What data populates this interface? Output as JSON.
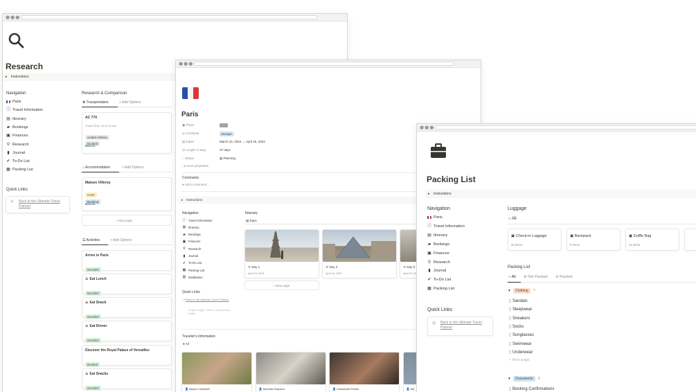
{
  "research": {
    "title": "Research",
    "instructions": "Instructions",
    "navigation_title": "Navigation",
    "nav": [
      {
        "label": "Paris",
        "icon": "flag-icon"
      },
      {
        "label": "Travel Information",
        "icon": "info-icon"
      },
      {
        "label": "Itinerary",
        "icon": "calendar-icon"
      },
      {
        "label": "Bookings",
        "icon": "ticket-icon"
      },
      {
        "label": "Finances",
        "icon": "money-icon"
      },
      {
        "label": "Research",
        "icon": "search-icon"
      },
      {
        "label": "Journal",
        "icon": "book-icon"
      },
      {
        "label": "To-Do List",
        "icon": "check-icon"
      },
      {
        "label": "Packing List",
        "icon": "luggage-icon"
      }
    ],
    "quick_links_title": "Quick Links",
    "quick_link": "Back to the Ultimate Travel Planner",
    "comparison_title": "Research & Comparison",
    "transport_tab": "Transportation",
    "add_options": "Add Options",
    "transport_card": {
      "title": "AC 774",
      "line": "Travel Time: 1h to 20 min",
      "airline": "United Airlines",
      "status": "Booked",
      "price": "$500.00"
    },
    "accommodation_tab": "Accommodation",
    "accommodation_card": {
      "title": "Maison Villeroy",
      "type": "Hotel",
      "status": "Booking",
      "price": "$320.00"
    },
    "new_page": "New page",
    "activities_tab": "Activities",
    "activities": [
      {
        "title": "Arrive in Paris",
        "status": "Decided"
      },
      {
        "title": "Eat Lunch",
        "status": "Decided"
      },
      {
        "title": "Eat Snack",
        "status": "Decided"
      },
      {
        "title": "Eat Dinner",
        "status": "Decided"
      },
      {
        "title": "Discover the Royal Palace of Versailles",
        "status": "Booked"
      },
      {
        "title": "Eat Snacks",
        "status": "Decided"
      }
    ]
  },
  "paris": {
    "title": "Paris",
    "props": [
      {
        "label": "Photo",
        "value": ""
      },
      {
        "label": "Continent",
        "value": "Europe"
      },
      {
        "label": "Dates",
        "value": "March 15, 2024 → April 25, 2024"
      },
      {
        "label": "Length of Stay",
        "value": "37 days"
      },
      {
        "label": "Status",
        "value": "Planning"
      }
    ],
    "more_props": "5 more properties",
    "comments_title": "Comments",
    "add_comment": "Add a comment...",
    "instructions": "Instructions",
    "navigation_title": "Navigation",
    "nav": [
      {
        "label": "Travel Information"
      },
      {
        "label": "Itinerary"
      },
      {
        "label": "Bookings"
      },
      {
        "label": "Finances"
      },
      {
        "label": "Research"
      },
      {
        "label": "Journal"
      },
      {
        "label": "To-Do List"
      },
      {
        "label": "Packing List"
      },
      {
        "label": "Databases"
      }
    ],
    "quick_links_title": "Quick Links",
    "quick_link": "Back to the Ultimate Travel Planner",
    "quick_link_hint": "Empty toggle. Click or drop blocks inside.",
    "itinerary_title": "Itinerary",
    "days_view": "Days",
    "days": [
      {
        "label": "Day 1",
        "date": "April 15, 2024"
      },
      {
        "label": "Day 2",
        "date": "April 16, 2024"
      },
      {
        "label": "Day 3",
        "date": "April 20, 2024"
      }
    ],
    "new_page": "New page",
    "travelers_title": "Traveler's Information",
    "travelers_view": "All",
    "travelers": [
      "Alyssa Campbell",
      "Amanda Simpson",
      "Cassandra Parker",
      "Ma"
    ]
  },
  "packing": {
    "title": "Packing List",
    "instructions": "Instructions",
    "navigation_title": "Navigation",
    "nav": [
      {
        "label": "Paris"
      },
      {
        "label": "Travel Information"
      },
      {
        "label": "Itinerary"
      },
      {
        "label": "Bookings"
      },
      {
        "label": "Finances"
      },
      {
        "label": "Research"
      },
      {
        "label": "Journal"
      },
      {
        "label": "To-Do List"
      },
      {
        "label": "Packing List"
      }
    ],
    "quick_links_title": "Quick Links",
    "quick_link": "Back to the Ultimate Travel Planner",
    "luggage_title": "Luggage",
    "luggage_view": "All",
    "luggage": [
      {
        "name": "Check-in Luggage",
        "count": "24 items"
      },
      {
        "name": "Backpack",
        "count": "8 items"
      },
      {
        "name": "Duffle Bag",
        "count": "12 items"
      }
    ],
    "list_title": "Packing List",
    "filters": [
      "All",
      "Not Packed",
      "Packed"
    ],
    "group_clothing": "Clothing",
    "group_clothing_count": "7",
    "clothing": [
      "Sandals",
      "Sleepwear",
      "Sneakers",
      "Socks",
      "Sunglasses",
      "Swimwear",
      "Underwear"
    ],
    "new_page": "New page",
    "group_documents": "Documents",
    "group_documents_count": "6",
    "documents": [
      "Booking Confirmations"
    ]
  }
}
